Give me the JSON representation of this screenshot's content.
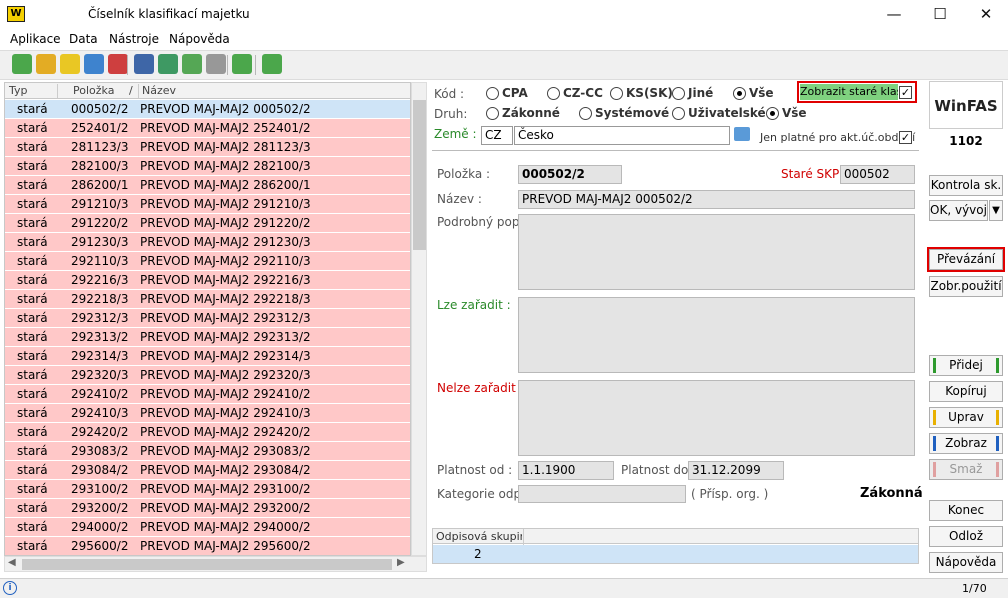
{
  "window": {
    "title": "Číselník klasifikací majetku",
    "logo_text": "W",
    "min": "—",
    "max": "☐",
    "close": "✕"
  },
  "menu": [
    "Aplikace",
    "Data",
    "Nástroje",
    "Nápověda"
  ],
  "toolbar": {
    "icons": [
      {
        "name": "new-icon",
        "color": "#2e9a2e"
      },
      {
        "name": "copy-icon",
        "color": "#e0a000"
      },
      {
        "name": "edit-icon",
        "color": "#e8c000"
      },
      {
        "name": "view-icon",
        "color": "#1e70c8"
      },
      {
        "name": "delete-icon",
        "color": "#c82020"
      },
      {
        "name": "print-icon",
        "color": "#1e4e9a"
      },
      {
        "name": "export-icon",
        "color": "#1e8a4a"
      },
      {
        "name": "list-icon",
        "color": "#3a9a3a"
      },
      {
        "name": "columns-icon",
        "color": "#888888"
      },
      {
        "name": "refresh-icon",
        "color": "#2e9a2e"
      },
      {
        "name": "help-icon",
        "color": "#2e9a2e"
      }
    ]
  },
  "grid": {
    "columns": [
      "Typ",
      "Položka",
      "Název"
    ],
    "sort_indicator": "/",
    "rows": [
      {
        "typ": "stará",
        "polozka": "000502/2",
        "nazev": "PREVOD MAJ-MAJ2 000502/2",
        "selected": true
      },
      {
        "typ": "stará",
        "polozka": "252401/2",
        "nazev": "PREVOD MAJ-MAJ2 252401/2"
      },
      {
        "typ": "stará",
        "polozka": "281123/3",
        "nazev": "PREVOD MAJ-MAJ2 281123/3"
      },
      {
        "typ": "stará",
        "polozka": "282100/3",
        "nazev": "PREVOD MAJ-MAJ2 282100/3"
      },
      {
        "typ": "stará",
        "polozka": "286200/1",
        "nazev": "PREVOD MAJ-MAJ2 286200/1"
      },
      {
        "typ": "stará",
        "polozka": "291210/3",
        "nazev": "PREVOD MAJ-MAJ2 291210/3"
      },
      {
        "typ": "stará",
        "polozka": "291220/2",
        "nazev": "PREVOD MAJ-MAJ2 291220/2"
      },
      {
        "typ": "stará",
        "polozka": "291230/3",
        "nazev": "PREVOD MAJ-MAJ2 291230/3"
      },
      {
        "typ": "stará",
        "polozka": "292110/3",
        "nazev": "PREVOD MAJ-MAJ2 292110/3"
      },
      {
        "typ": "stará",
        "polozka": "292216/3",
        "nazev": "PREVOD MAJ-MAJ2 292216/3"
      },
      {
        "typ": "stará",
        "polozka": "292218/3",
        "nazev": "PREVOD MAJ-MAJ2 292218/3"
      },
      {
        "typ": "stará",
        "polozka": "292312/3",
        "nazev": "PREVOD MAJ-MAJ2 292312/3"
      },
      {
        "typ": "stará",
        "polozka": "292313/2",
        "nazev": "PREVOD MAJ-MAJ2 292313/2"
      },
      {
        "typ": "stará",
        "polozka": "292314/3",
        "nazev": "PREVOD MAJ-MAJ2 292314/3"
      },
      {
        "typ": "stará",
        "polozka": "292320/3",
        "nazev": "PREVOD MAJ-MAJ2 292320/3"
      },
      {
        "typ": "stará",
        "polozka": "292410/2",
        "nazev": "PREVOD MAJ-MAJ2 292410/2"
      },
      {
        "typ": "stará",
        "polozka": "292410/3",
        "nazev": "PREVOD MAJ-MAJ2 292410/3"
      },
      {
        "typ": "stará",
        "polozka": "292420/2",
        "nazev": "PREVOD MAJ-MAJ2 292420/2"
      },
      {
        "typ": "stará",
        "polozka": "293083/2",
        "nazev": "PREVOD MAJ-MAJ2 293083/2"
      },
      {
        "typ": "stará",
        "polozka": "293084/2",
        "nazev": "PREVOD MAJ-MAJ2 293084/2"
      },
      {
        "typ": "stará",
        "polozka": "293100/2",
        "nazev": "PREVOD MAJ-MAJ2 293100/2"
      },
      {
        "typ": "stará",
        "polozka": "293200/2",
        "nazev": "PREVOD MAJ-MAJ2 293200/2"
      },
      {
        "typ": "stará",
        "polozka": "294000/2",
        "nazev": "PREVOD MAJ-MAJ2 294000/2"
      },
      {
        "typ": "stará",
        "polozka": "295600/2",
        "nazev": "PREVOD MAJ-MAJ2 295600/2"
      }
    ]
  },
  "filters": {
    "kod_label": "Kód :",
    "kod_options": [
      "CPA",
      "CZ-CC",
      "KS(SK)",
      "Jiné",
      "Vše"
    ],
    "kod_selected": "Vše",
    "druh_label": "Druh:",
    "druh_options": [
      "Zákonné",
      "Systémové",
      "Uživatelské",
      "Vše"
    ],
    "druh_selected": "Vše",
    "zeme_label": "Země :",
    "zeme_code": "CZ",
    "zeme_name": "Česko",
    "show_old_label": "Zobrazit staré klasif.",
    "show_old_checked": true,
    "only_valid_label": "Jen platné pro akt.úč.období",
    "only_valid_checked": true
  },
  "detail": {
    "polozka_label": "Položka :",
    "polozka_value": "000502/2",
    "stare_skp_label": "Staré SKP :",
    "stare_skp_value": "000502",
    "nazev_label": "Název :",
    "nazev_value": "PREVOD MAJ-MAJ2 000502/2",
    "popis_label": "Podrobný popis :",
    "lze_label": "Lze zařadit :",
    "nelze_label": "Nelze zařadit :",
    "platnost_od_label": "Platnost od :",
    "platnost_od_value": "1.1.1900",
    "platnost_do_label": "Platnost do :",
    "platnost_do_value": "31.12.2099",
    "kategorie_label": "Kategorie odp. :",
    "kategorie_value": "",
    "prisp_label": "( Přísp. org. )",
    "druh_value": "Zákonná",
    "odpis_header": "Odpisová skupina",
    "odpis_value": "2"
  },
  "sidebar": {
    "brand": "WinFAS",
    "number": "1102",
    "buttons": {
      "kontrola": "Kontrola sk.",
      "ok_vyvoj": "OK, vývoj",
      "prevazani": "Převázání",
      "zobr_pouziti": "Zobr.použití",
      "pridej": "Přidej",
      "kopiruj": "Kopíruj",
      "uprav": "Uprav",
      "zobraz": "Zobraz",
      "smaz": "Smaž",
      "konec": "Konec",
      "odloz": "Odlož",
      "napoveda": "Nápověda"
    }
  },
  "status": {
    "info": "i",
    "pager": "1/70"
  },
  "colors": {
    "old_row": "#ffc8c8",
    "selected_row": "#cfe4f7",
    "highlight_green": "#7fd17f",
    "red_frame": "#e00000",
    "zeme_green": "#2a8a2a",
    "lze_green": "#2a8a2a",
    "nelze_red": "#d00000",
    "stare_red": "#d00000"
  }
}
